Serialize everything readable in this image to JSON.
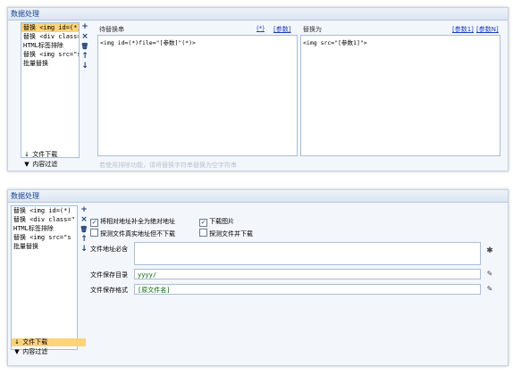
{
  "top": {
    "title": "数据处理",
    "list_items": [
      "替换 <img id=(*)",
      "替换 <div  class=\"",
      "HTML标签排除",
      "替换 <img  src=\"s",
      "批量替换"
    ],
    "toolbar": {
      "add": "+",
      "delete": "×",
      "trash": "🗑",
      "up": "↑",
      "down": "↓"
    },
    "sub_buttons": [
      {
        "icon": "↓",
        "label": "文件下载"
      },
      {
        "icon": "▼",
        "label": "内容过滤"
      }
    ],
    "find_header": "待替换串",
    "find_links": [
      "(*)",
      "[参数]"
    ],
    "replace_header": "替换为",
    "replace_links": [
      "[参数1]",
      "[参数N]"
    ],
    "find_value": "<img id=(*)file=\"[参数]\"(*)>",
    "replace_value": "<img src=\"[参数1]\">",
    "hint": "若使用排除功能，请将替换字符串替换为空字符串"
  },
  "bottom": {
    "title": "数据处理",
    "list_items": [
      "替换 <img id=(*)",
      "替换 <div  class=\"",
      "HTML标签排除",
      "替换 <img  src=\"s",
      "批量替换"
    ],
    "toolbar": {
      "add": "+",
      "delete": "×",
      "trash": "🗑",
      "up": "↑",
      "down": "↓"
    },
    "sub_buttons": [
      {
        "icon": "↓",
        "label": "文件下载"
      },
      {
        "icon": "▼",
        "label": "内容过滤"
      }
    ],
    "checkboxes": [
      {
        "label": "将相对地址补全为绝对地址",
        "checked": true
      },
      {
        "label": "下载图片",
        "checked": true
      },
      {
        "label": "探测文件真实地址但不下载",
        "checked": false
      },
      {
        "label": "探测文件并下载",
        "checked": false
      }
    ],
    "check_glyph": "✓",
    "url_must_contain_label": "文件地址必含",
    "url_must_contain_value": "",
    "save_dir_label": "文件保存目录",
    "save_dir_value": "yyyy/",
    "save_format_label": "文件保存格式",
    "save_format_value": "[原文件名]",
    "gear_icon": "✱",
    "edit_icon": "✎"
  }
}
